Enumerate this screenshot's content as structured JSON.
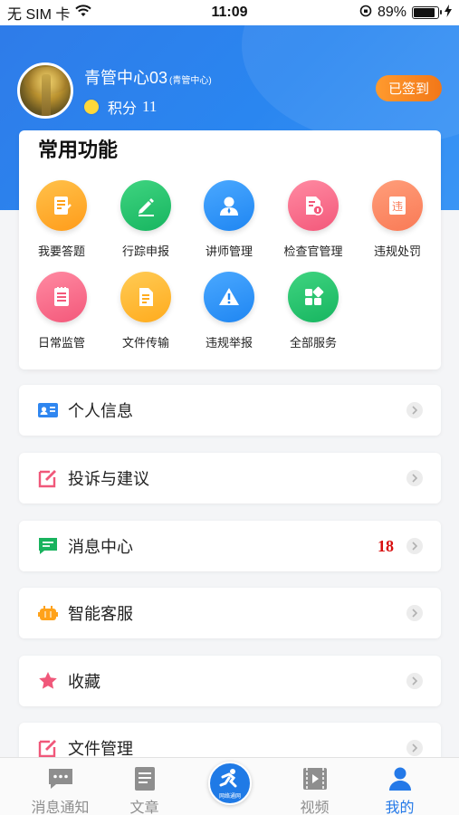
{
  "status_bar": {
    "carrier": "无 SIM 卡",
    "time": "11:09",
    "battery_percent": "89%",
    "battery_level": 0.89
  },
  "profile": {
    "name": "青管中心03",
    "org": "(青管中心)",
    "points_label": "积分",
    "points_value": "11",
    "signin_label": "已签到"
  },
  "common_functions": {
    "title": "常用功能",
    "items": [
      {
        "label": "我要答题",
        "icon": "edit-note-icon"
      },
      {
        "label": "行踪申报",
        "icon": "pencil-icon"
      },
      {
        "label": "讲师管理",
        "icon": "user-icon"
      },
      {
        "label": "检查官管理",
        "icon": "document-info-icon"
      },
      {
        "label": "违规处罚",
        "icon": "violation-icon"
      },
      {
        "label": "日常监管",
        "icon": "list-icon"
      },
      {
        "label": "文件传输",
        "icon": "file-icon"
      },
      {
        "label": "违规举报",
        "icon": "warning-icon"
      },
      {
        "label": "全部服务",
        "icon": "grid-icon"
      }
    ]
  },
  "menu": [
    {
      "label": "个人信息",
      "icon": "id-card-icon",
      "color": "#2f86f0"
    },
    {
      "label": "投诉与建议",
      "icon": "edit-icon",
      "color": "#f0587a"
    },
    {
      "label": "消息中心",
      "icon": "message-icon",
      "color": "#19b35e",
      "badge": "18"
    },
    {
      "label": "智能客服",
      "icon": "robot-icon",
      "color": "#ffa21a"
    },
    {
      "label": "收藏",
      "icon": "star-icon",
      "color": "#f0587a"
    },
    {
      "label": "文件管理",
      "icon": "edit-icon",
      "color": "#f0587a"
    }
  ],
  "tabbar": {
    "items": [
      {
        "label": "消息通知",
        "icon": "chat-icon"
      },
      {
        "label": "文章",
        "icon": "article-icon"
      },
      {
        "label": "",
        "icon": "center-logo-icon"
      },
      {
        "label": "视频",
        "icon": "video-icon"
      },
      {
        "label": "我的",
        "icon": "person-icon",
        "active": true
      }
    ],
    "center_label": "网络通网"
  },
  "colors": {
    "header_blue": "#2a86f0",
    "tab_active": "#2479e8",
    "badge_red": "#d80f0f",
    "signin_orange": "#f27718"
  }
}
